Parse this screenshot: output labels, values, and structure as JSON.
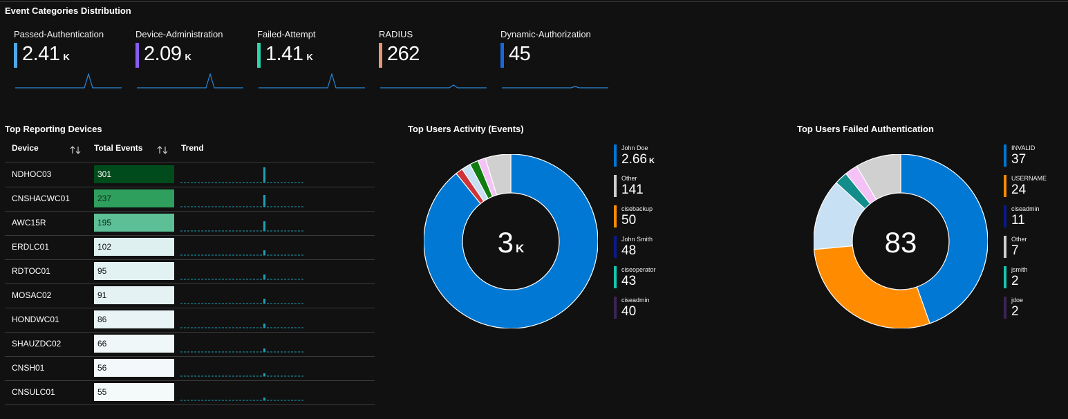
{
  "event_categories": {
    "title": "Event Categories Distribution",
    "tiles": [
      {
        "label": "Passed-Authentication",
        "value": "2.41",
        "suffix": "K",
        "color": "#4fa9e8"
      },
      {
        "label": "Device-Administration",
        "value": "2.09",
        "suffix": "K",
        "color": "#8a5cf0"
      },
      {
        "label": "Failed-Attempt",
        "value": "1.41",
        "suffix": "K",
        "color": "#2dd4b0"
      },
      {
        "label": "RADIUS",
        "value": "262",
        "suffix": "",
        "color": "#e8967a"
      },
      {
        "label": "Dynamic-Authorization",
        "value": "45",
        "suffix": "",
        "color": "#1769d9"
      }
    ]
  },
  "devices": {
    "title": "Top Reporting Devices",
    "headers": {
      "device": "Device",
      "total": "Total Events",
      "trend": "Trend"
    },
    "rows": [
      {
        "device": "NDHOC03",
        "total": "301",
        "bg": "#004b1c",
        "fg": "#ffffff",
        "level": 1.0
      },
      {
        "device": "CNSHACWC01",
        "total": "237",
        "bg": "#2e9f5c",
        "fg": "#0b2a16",
        "level": 0.79
      },
      {
        "device": "AWC15R",
        "total": "195",
        "bg": "#5cbf96",
        "fg": "#0b2a16",
        "level": 0.65
      },
      {
        "device": "ERDLC01",
        "total": "102",
        "bg": "#dff0f0",
        "fg": "#111111",
        "level": 0.34
      },
      {
        "device": "RDTOC01",
        "total": "95",
        "bg": "#e2f1f2",
        "fg": "#111111",
        "level": 0.32
      },
      {
        "device": "MOSAC02",
        "total": "91",
        "bg": "#e4f2f3",
        "fg": "#111111",
        "level": 0.3
      },
      {
        "device": "HONDWC01",
        "total": "86",
        "bg": "#e8f4f5",
        "fg": "#111111",
        "level": 0.29
      },
      {
        "device": "SHAUZDC02",
        "total": "66",
        "bg": "#eff7f8",
        "fg": "#111111",
        "level": 0.22
      },
      {
        "device": "CNSH01",
        "total": "56",
        "bg": "#f3f9fa",
        "fg": "#111111",
        "level": 0.19
      },
      {
        "device": "CNSULC01",
        "total": "55",
        "bg": "#f4fafa",
        "fg": "#111111",
        "level": 0.18
      }
    ]
  },
  "users_activity": {
    "title": "Top Users Activity (Events)",
    "center_value": "3",
    "center_suffix": "K",
    "legend": [
      {
        "name": "John Doe",
        "value": "2.66",
        "suffix": "K",
        "color": "#0078d4"
      },
      {
        "name": "Other",
        "value": "141",
        "suffix": "",
        "color": "#d0d0d0"
      },
      {
        "name": "cisebackup",
        "value": "50",
        "suffix": "",
        "color": "#ff8c00"
      },
      {
        "name": "John Smith",
        "value": "48",
        "suffix": "",
        "color": "#0b1a8a"
      },
      {
        "name": "ciseoperator",
        "value": "43",
        "suffix": "",
        "color": "#17c7b3"
      },
      {
        "name": "ciseadmin",
        "value": "40",
        "suffix": "",
        "color": "#3b2456"
      }
    ]
  },
  "users_failed": {
    "title": "Top Users Failed Authentication",
    "center_value": "83",
    "legend": [
      {
        "name": "INVALID",
        "value": "37",
        "color": "#0078d4"
      },
      {
        "name": "USERNAME",
        "value": "24",
        "color": "#ff8c00"
      },
      {
        "name": "ciseadmin",
        "value": "11",
        "color": "#0b1a8a"
      },
      {
        "name": "Other",
        "value": "7",
        "color": "#d0d0d0"
      },
      {
        "name": "jsmith",
        "value": "2",
        "color": "#17c7b3"
      },
      {
        "name": "jdoe",
        "value": "2",
        "color": "#3b2456"
      }
    ]
  },
  "chart_data": [
    {
      "type": "pie",
      "title": "Top Users Activity (Events)",
      "categories": [
        "John Doe",
        "ciseadmin",
        "cisebackup",
        "John Smith",
        "ciseoperator",
        "Other"
      ],
      "values": [
        2660,
        40,
        50,
        48,
        43,
        141
      ],
      "colors": [
        "#0078d4",
        "#d13438",
        "#c7e0f4",
        "#107c10",
        "#f4c2f7",
        "#d0d0d0"
      ]
    },
    {
      "type": "pie",
      "title": "Top Users Failed Authentication",
      "categories": [
        "INVALID",
        "USERNAME",
        "ciseadmin",
        "jsmith",
        "jdoe",
        "Other"
      ],
      "values": [
        37,
        24,
        11,
        2,
        2,
        7
      ],
      "colors": [
        "#0078d4",
        "#ff8c00",
        "#c7e0f4",
        "#138c8c",
        "#f4c2f7",
        "#d0d0d0"
      ]
    }
  ]
}
